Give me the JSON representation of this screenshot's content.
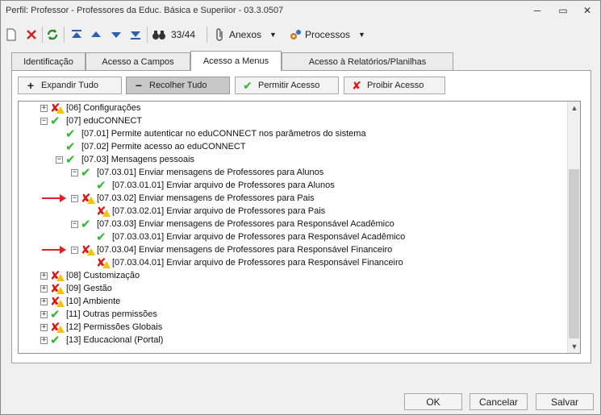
{
  "window": {
    "title": "Perfil: Professor - Professores da Educ. Básica  e Superiior - 03.3.0507",
    "controls": [
      "─",
      "▭",
      "✕"
    ]
  },
  "toolbar": {
    "record_counter": "33/44",
    "anexos_label": "Anexos",
    "processos_label": "Processos"
  },
  "tabs": [
    {
      "label": "Identificação",
      "active": false
    },
    {
      "label": "Acesso a Campos",
      "active": false
    },
    {
      "label": "Acesso a Menus",
      "active": true
    },
    {
      "label": "Acesso à Relatórios/Planilhas",
      "active": false
    }
  ],
  "actions": {
    "expand_label": "Expandir Tudo",
    "collapse_label": "Recolher Tudo",
    "allow_label": "Permitir Acesso",
    "deny_label": "Proibir Acesso"
  },
  "tree": [
    {
      "label": "[06] Configurações",
      "level": 0,
      "state": "partial",
      "expander": "+"
    },
    {
      "label": "[07] eduCONNECT",
      "level": 0,
      "state": "allowed",
      "expander": "−"
    },
    {
      "label": "[07.01] Permite autenticar no eduCONNECT nos parâmetros do sistema",
      "level": 1,
      "state": "allowed",
      "expander": ""
    },
    {
      "label": "[07.02] Permite acesso ao eduCONNECT",
      "level": 1,
      "state": "allowed",
      "expander": ""
    },
    {
      "label": "[07.03] Mensagens pessoais",
      "level": 1,
      "state": "allowed",
      "expander": "−"
    },
    {
      "label": "[07.03.01] Enviar mensagens de Professores para Alunos",
      "level": 2,
      "state": "allowed",
      "expander": "−"
    },
    {
      "label": "[07.03.01.01] Enviar arquivo de Professores para Alunos",
      "level": 3,
      "state": "allowed",
      "expander": ""
    },
    {
      "label": "[07.03.02] Enviar mensagens de Professores para Pais",
      "level": 2,
      "state": "partial",
      "expander": "−",
      "pointer": true
    },
    {
      "label": "[07.03.02.01] Enviar arquivo de Professores para Pais",
      "level": 3,
      "state": "partial",
      "expander": ""
    },
    {
      "label": "[07.03.03] Enviar mensagens de Professores para Responsável Acadêmico",
      "level": 2,
      "state": "allowed",
      "expander": "−"
    },
    {
      "label": "[07.03.03.01] Enviar arquivo de Professores para Responsável Acadêmico",
      "level": 3,
      "state": "allowed",
      "expander": ""
    },
    {
      "label": "[07.03.04] Enviar mensagens de Professores para Responsável Financeiro",
      "level": 2,
      "state": "partial",
      "expander": "−",
      "pointer": true
    },
    {
      "label": "[07.03.04.01] Enviar arquivo de Professores para Responsável Financeiro",
      "level": 3,
      "state": "partial",
      "expander": ""
    },
    {
      "label": "[08] Customização",
      "level": 0,
      "state": "partial",
      "expander": "+"
    },
    {
      "label": "[09] Gestão",
      "level": 0,
      "state": "partial",
      "expander": "+"
    },
    {
      "label": "[10] Ambiente",
      "level": 0,
      "state": "partial",
      "expander": "+"
    },
    {
      "label": "[11] Outras permissões",
      "level": 0,
      "state": "allowed",
      "expander": "+"
    },
    {
      "label": "[12] Permissões Globais",
      "level": 0,
      "state": "partial",
      "expander": "+"
    },
    {
      "label": "[13] Educacional (Portal)",
      "level": 0,
      "state": "allowed",
      "expander": "+"
    }
  ],
  "footer": {
    "ok_label": "OK",
    "cancel_label": "Cancelar",
    "save_label": "Salvar"
  },
  "colors": {
    "allowed": "#2eb82e",
    "denied": "#e01818",
    "warning": "#f4c400",
    "pointer": "#e02020"
  }
}
